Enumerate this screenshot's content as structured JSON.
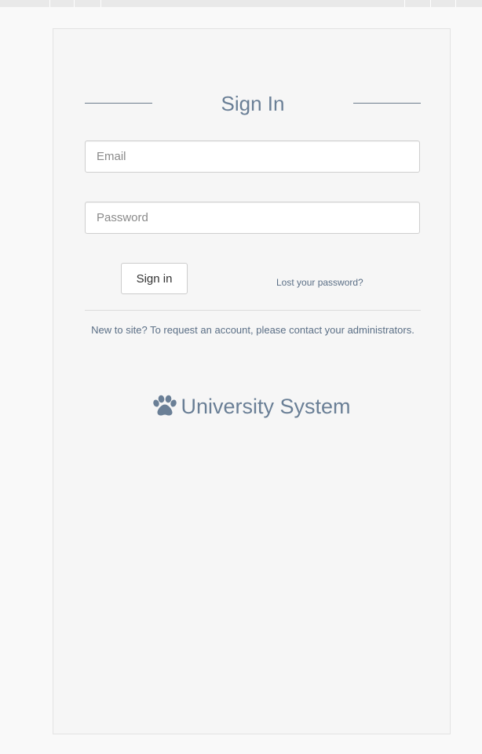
{
  "login": {
    "heading": "Sign In",
    "email_placeholder": "Email",
    "password_placeholder": "Password",
    "signin_label": "Sign in",
    "lost_password": "Lost your password?",
    "new_to_site": "New to site? To request an account, please contact your administrators."
  },
  "brand": {
    "icon": "paw-icon",
    "name": "University System"
  },
  "colors": {
    "accent": "#6a7f96",
    "link": "#5b6f86",
    "panel": "#f6f6f6"
  }
}
